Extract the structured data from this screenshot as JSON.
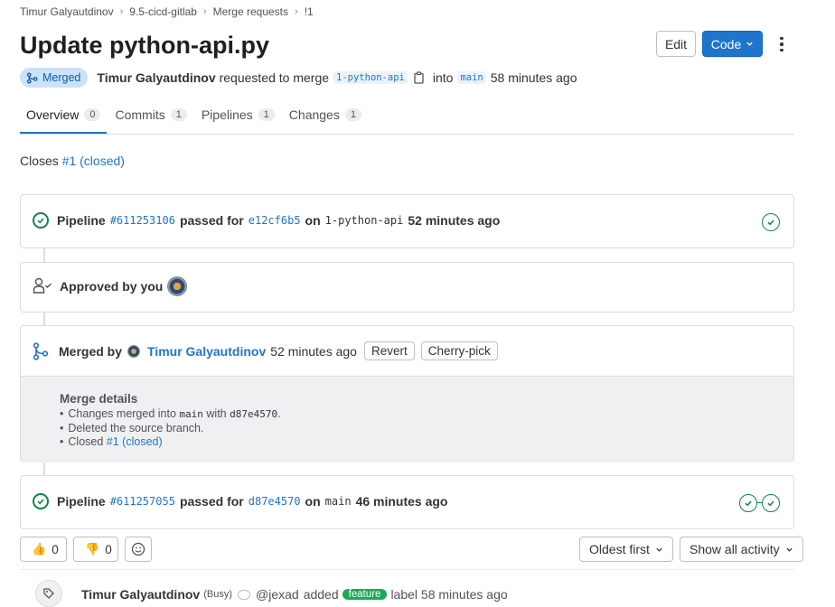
{
  "breadcrumb": [
    "Timur Galyautdinov",
    "9.5-cicd-gitlab",
    "Merge requests",
    "!1"
  ],
  "title": "Update python-api.py",
  "header_actions": {
    "edit": "Edit",
    "code": "Code"
  },
  "status_badge": "Merged",
  "meta": {
    "author": "Timur Galyautdinov",
    "requested": "requested to merge",
    "source_branch": "1-python-api",
    "into": "into",
    "target_branch": "main",
    "time": "58 minutes ago"
  },
  "tabs": [
    {
      "label": "Overview",
      "count": "0"
    },
    {
      "label": "Commits",
      "count": "1"
    },
    {
      "label": "Pipelines",
      "count": "1"
    },
    {
      "label": "Changes",
      "count": "1"
    }
  ],
  "closes": {
    "prefix": "Closes",
    "issue": "#1 (closed)"
  },
  "pipeline1": {
    "label": "Pipeline",
    "id": "#611253106",
    "passed": "passed for",
    "sha": "e12cf6b5",
    "on": "on",
    "branch": "1-python-api",
    "time": "52 minutes ago"
  },
  "approval": {
    "text": "Approved by you"
  },
  "merged": {
    "by": "Merged by",
    "user": "Timur Galyautdinov",
    "time": "52 minutes ago",
    "revert": "Revert",
    "cherry": "Cherry-pick",
    "details_title": "Merge details",
    "line1_a": "Changes merged into",
    "line1_branch": "main",
    "line1_b": "with",
    "line1_sha": "d87e4570",
    "line1_end": ".",
    "line2": "Deleted the source branch.",
    "line3_a": "Closed",
    "line3_issue": "#1 (closed)"
  },
  "pipeline2": {
    "label": "Pipeline",
    "id": "#611257055",
    "passed": "passed for",
    "sha": "d87e4570",
    "on": "on",
    "branch": "main",
    "time": "46 minutes ago"
  },
  "reactions": {
    "thumbs_up": "0",
    "thumbs_down": "0"
  },
  "sort": {
    "order": "Oldest first",
    "filter": "Show all activity"
  },
  "activity": {
    "user": "Timur Galyautdinov",
    "status": "(Busy)",
    "handle": "@jexad",
    "added": "added",
    "label": "feature",
    "suffix": "label 58 minutes ago"
  },
  "colors": {
    "accent": "#1f75cb",
    "success": "#108548",
    "merged_badge_bg": "#cbe2f9",
    "label_feature": "#1aaa55"
  }
}
